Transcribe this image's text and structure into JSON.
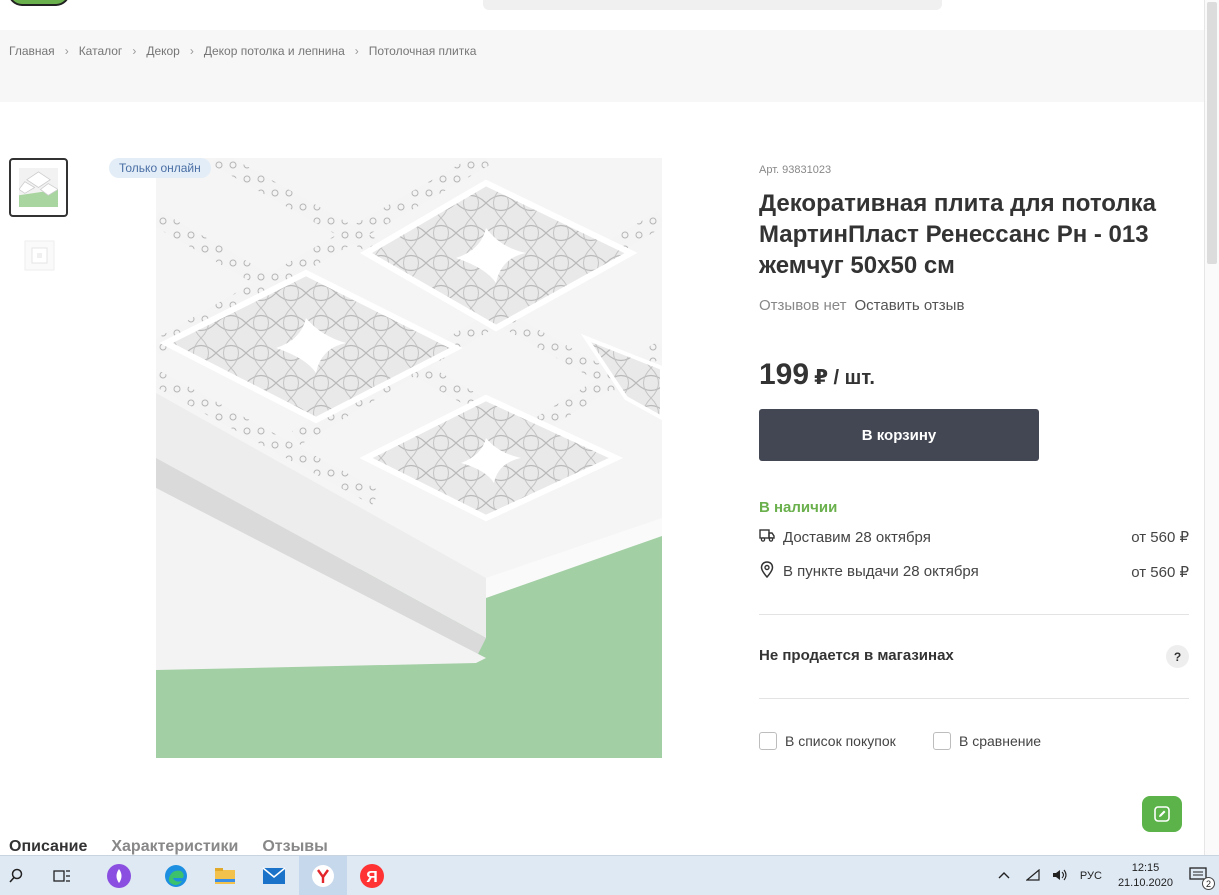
{
  "breadcrumb": [
    "Главная",
    "Каталог",
    "Декор",
    "Декор потолка и лепнина",
    "Потолочная плитка"
  ],
  "badge": "Только онлайн",
  "product": {
    "article": "Арт. 93831023",
    "title": "Декоративная плита для потолка МартинПласт Ренессанс Рн - 013 жемчуг 50х50 см",
    "reviews_none": "Отзывов нет",
    "leave_review": "Оставить отзыв",
    "price": "199",
    "price_unit": "₽ / шт.",
    "cart_button": "В корзину",
    "stock": "В наличии",
    "delivery": [
      {
        "icon": "truck-icon",
        "label": "Доставим 28 октября",
        "cost": "от 560 ₽"
      },
      {
        "icon": "location-pin-icon",
        "label": "В пункте выдачи 28 октября",
        "cost": "от 560 ₽"
      }
    ],
    "not_sold": "Не продается в магазинах",
    "help": "?",
    "checks": [
      "В список покупок",
      "В сравнение"
    ]
  },
  "tabs": [
    "Описание",
    "Характеристики",
    "Отзывы"
  ],
  "taskbar": {
    "lang": "РУС",
    "time": "12:15",
    "date": "21.10.2020",
    "notifications": "2"
  },
  "colors": {
    "accent_green": "#6ab04c",
    "cart_button": "#434753",
    "badge_bg": "#e3edf7"
  }
}
